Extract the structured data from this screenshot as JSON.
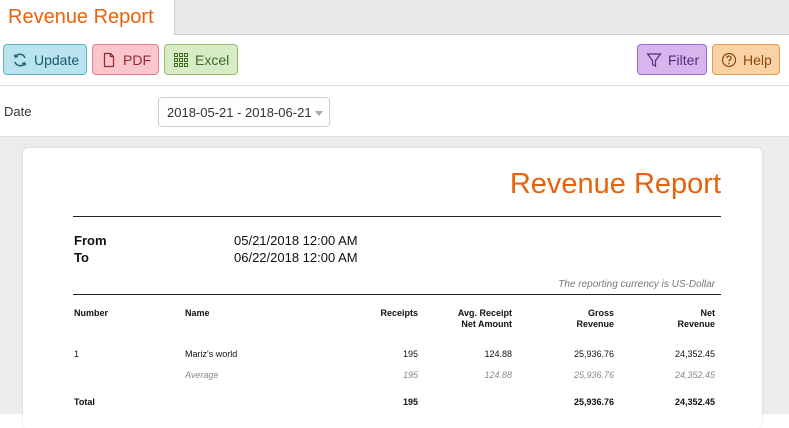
{
  "tab": {
    "title": "Revenue Report"
  },
  "toolbar": {
    "update": "Update",
    "pdf": "PDF",
    "excel": "Excel",
    "filter": "Filter",
    "help": "Help"
  },
  "filters": {
    "date_label": "Date",
    "date_value": "2018-05-21 - 2018-06-21"
  },
  "report": {
    "title": "Revenue Report",
    "from_label": "From",
    "from_value": "05/21/2018 12:00 AM",
    "to_label": "To",
    "to_value": "06/22/2018 12:00 AM",
    "currency_note": "The reporting currency is US-Dollar",
    "columns": {
      "number": "Number",
      "name": "Name",
      "receipts": "Receipts",
      "avg_line1": "Avg. Receipt",
      "avg_line2": "Net Amount",
      "gross_line1": "Gross",
      "gross_line2": "Revenue",
      "net_line1": "Net",
      "net_line2": "Revenue"
    },
    "row": {
      "number": "1",
      "name": "Mariz's world",
      "receipts": "195",
      "avg": "124.88",
      "gross": "25,936.76",
      "net": "24,352.45"
    },
    "average": {
      "label": "Average",
      "receipts": "195",
      "avg": "124.88",
      "gross": "25,936.76",
      "net": "24,352.45"
    },
    "total": {
      "label": "Total",
      "receipts": "195",
      "gross": "25,936.76",
      "net": "24,352.45"
    }
  },
  "colors": {
    "accent": "#e8620c"
  }
}
